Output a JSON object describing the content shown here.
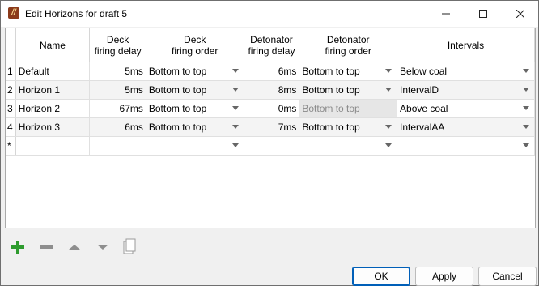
{
  "window": {
    "title": "Edit Horizons for draft 5",
    "app_icon": "//",
    "min_glyph": "—",
    "max_glyph": "☐",
    "close_glyph": "✕"
  },
  "table": {
    "headers": [
      "",
      "Name",
      "Deck\nfiring delay",
      "Deck\nfiring order",
      "Detonator\nfiring delay",
      "Detonator\nfiring order",
      "Intervals"
    ],
    "rows": [
      {
        "row": "1",
        "name": "Default",
        "deck_delay": "5ms",
        "deck_order": "Bottom to top",
        "det_delay": "6ms",
        "det_order": "Bottom to top",
        "interval": "Below coal"
      },
      {
        "row": "2",
        "name": "Horizon 1",
        "deck_delay": "5ms",
        "deck_order": "Bottom to top",
        "det_delay": "8ms",
        "det_order": "Bottom to top",
        "interval": "IntervalD"
      },
      {
        "row": "3",
        "name": "Horizon 2",
        "deck_delay": "67ms",
        "deck_order": "Bottom to top",
        "det_delay": "0ms",
        "det_order": "Bottom to top",
        "interval": "Above coal"
      },
      {
        "row": "4",
        "name": "Horizon 3",
        "deck_delay": "6ms",
        "deck_order": "Bottom to top",
        "det_delay": "7ms",
        "det_order": "Bottom to top",
        "interval": "IntervalAA"
      },
      {
        "row": "*",
        "name": "",
        "deck_delay": "",
        "deck_order": "",
        "det_delay": "",
        "det_order": "",
        "interval": ""
      }
    ]
  },
  "toolbar": {
    "icons": [
      "plus-icon",
      "minus-icon",
      "arrow-up-icon",
      "arrow-down-icon",
      "copy-icon"
    ],
    "colors": {
      "plus": "#2e9b2e",
      "disabled": "#8e8e8e"
    }
  },
  "buttons": {
    "ok": "OK",
    "apply": "Apply",
    "cancel": "Cancel"
  }
}
